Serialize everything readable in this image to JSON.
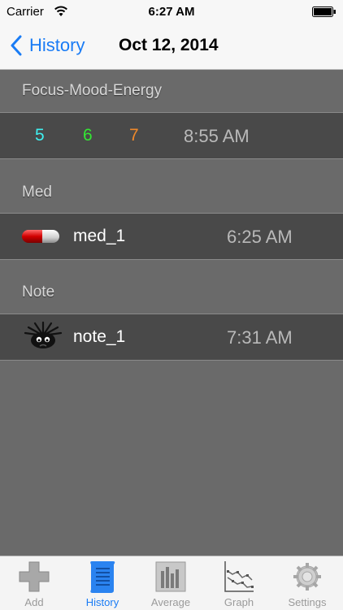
{
  "status_bar": {
    "carrier": "Carrier",
    "time": "6:27 AM"
  },
  "nav": {
    "back_label": "History",
    "title": "Oct 12, 2014"
  },
  "sections": {
    "fme": {
      "header": "Focus-Mood-Energy",
      "focus": "5",
      "mood": "6",
      "energy": "7",
      "time": "8:55 AM",
      "colors": {
        "focus": "#3ff0f0",
        "mood": "#33e533",
        "energy": "#f0892a"
      }
    },
    "med": {
      "header": "Med",
      "name": "med_1",
      "time": "6:25 AM",
      "icon": "pill-icon"
    },
    "note": {
      "header": "Note",
      "name": "note_1",
      "time": "7:31 AM",
      "icon": "note-face-icon"
    }
  },
  "tabs": [
    {
      "label": "Add",
      "icon": "plus-icon",
      "active": false
    },
    {
      "label": "History",
      "icon": "scroll-icon",
      "active": true
    },
    {
      "label": "Average",
      "icon": "bar-chart-icon",
      "active": false
    },
    {
      "label": "Graph",
      "icon": "line-graph-icon",
      "active": false
    },
    {
      "label": "Settings",
      "icon": "gear-icon",
      "active": false
    }
  ],
  "colors": {
    "accent": "#1a7cf5",
    "background": "#6a6a6a",
    "row": "#494949"
  }
}
